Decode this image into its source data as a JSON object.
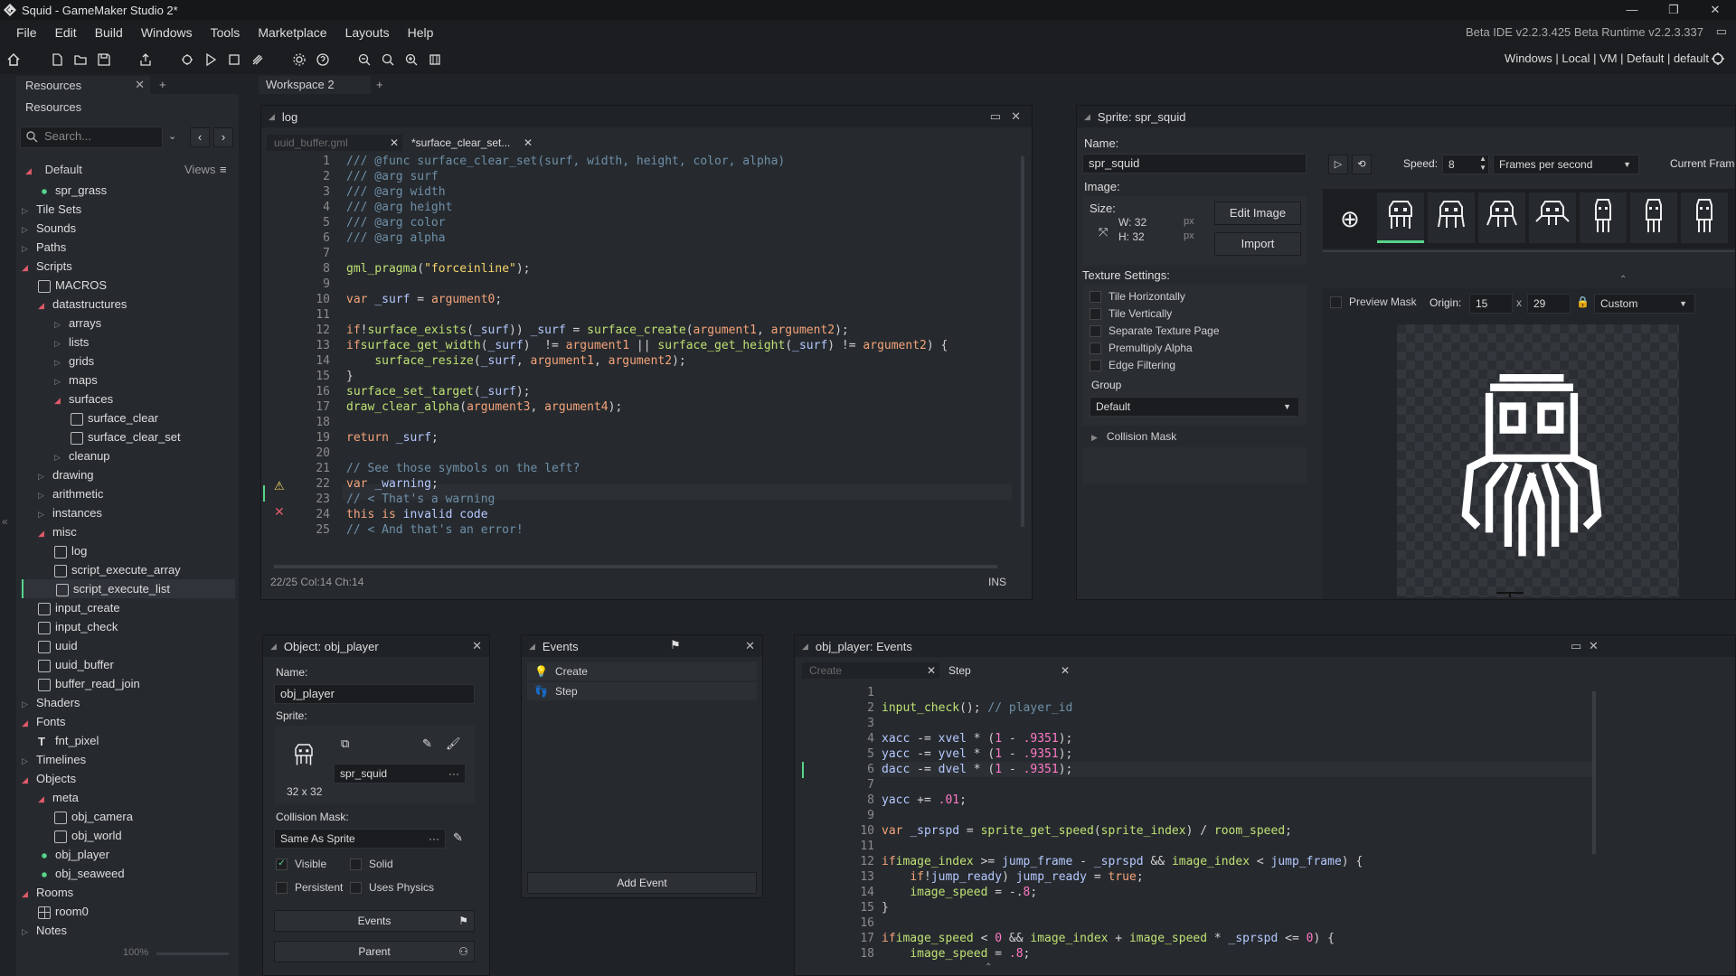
{
  "window": {
    "title": "Squid - GameMaker Studio 2*",
    "minimize": "—",
    "restore": "❐",
    "close": "✕"
  },
  "menu": [
    "File",
    "Edit",
    "Build",
    "Windows",
    "Tools",
    "Marketplace",
    "Layouts",
    "Help"
  ],
  "version": "Beta IDE v2.2.3.425 Beta Runtime v2.2.3.337",
  "targets": "Windows | Local | VM | Default | default",
  "resources": {
    "tab": "Resources",
    "panel_title": "Resources",
    "search_placeholder": "Search...",
    "group": "Default",
    "views": "Views",
    "zoom": "100%",
    "tree": [
      {
        "label": "spr_grass",
        "indent": 1,
        "icon": "sprite"
      },
      {
        "label": "Tile Sets",
        "indent": 0,
        "tri": "closed"
      },
      {
        "label": "Sounds",
        "indent": 0,
        "tri": "closed"
      },
      {
        "label": "Paths",
        "indent": 0,
        "tri": "closed"
      },
      {
        "label": "Scripts",
        "indent": 0,
        "tri": "open"
      },
      {
        "label": "MACROS",
        "indent": 1,
        "icon": "script"
      },
      {
        "label": "datastructures",
        "indent": 1,
        "tri": "open"
      },
      {
        "label": "arrays",
        "indent": 2,
        "tri": "closed"
      },
      {
        "label": "lists",
        "indent": 2,
        "tri": "closed"
      },
      {
        "label": "grids",
        "indent": 2,
        "tri": "closed"
      },
      {
        "label": "maps",
        "indent": 2,
        "tri": "closed"
      },
      {
        "label": "surfaces",
        "indent": 2,
        "tri": "open"
      },
      {
        "label": "surface_clear",
        "indent": 3,
        "icon": "script"
      },
      {
        "label": "surface_clear_set",
        "indent": 3,
        "icon": "script"
      },
      {
        "label": "cleanup",
        "indent": 2,
        "tri": "closed"
      },
      {
        "label": "drawing",
        "indent": 1,
        "tri": "closed"
      },
      {
        "label": "arithmetic",
        "indent": 1,
        "tri": "closed"
      },
      {
        "label": "instances",
        "indent": 1,
        "tri": "closed"
      },
      {
        "label": "misc",
        "indent": 1,
        "tri": "open"
      },
      {
        "label": "log",
        "indent": 2,
        "icon": "script"
      },
      {
        "label": "script_execute_array",
        "indent": 2,
        "icon": "script"
      },
      {
        "label": "script_execute_list",
        "indent": 2,
        "icon": "script",
        "selected": true
      },
      {
        "label": "input_create",
        "indent": 1,
        "icon": "script"
      },
      {
        "label": "input_check",
        "indent": 1,
        "icon": "script"
      },
      {
        "label": "uuid",
        "indent": 1,
        "icon": "script"
      },
      {
        "label": "uuid_buffer",
        "indent": 1,
        "icon": "script"
      },
      {
        "label": "buffer_read_join",
        "indent": 1,
        "icon": "script"
      },
      {
        "label": "Shaders",
        "indent": 0,
        "tri": "closed"
      },
      {
        "label": "Fonts",
        "indent": 0,
        "tri": "open"
      },
      {
        "label": "fnt_pixel",
        "indent": 1,
        "icon": "font"
      },
      {
        "label": "Timelines",
        "indent": 0,
        "tri": "closed"
      },
      {
        "label": "Objects",
        "indent": 0,
        "tri": "open"
      },
      {
        "label": "meta",
        "indent": 1,
        "tri": "open"
      },
      {
        "label": "obj_camera",
        "indent": 2,
        "icon": "object"
      },
      {
        "label": "obj_world",
        "indent": 2,
        "icon": "object"
      },
      {
        "label": "obj_player",
        "indent": 1,
        "icon": "sprite"
      },
      {
        "label": "obj_seaweed",
        "indent": 1,
        "icon": "sprite"
      },
      {
        "label": "Rooms",
        "indent": 0,
        "tri": "open"
      },
      {
        "label": "room0",
        "indent": 1,
        "icon": "room"
      },
      {
        "label": "Notes",
        "indent": 0,
        "tri": "closed"
      }
    ]
  },
  "workspace": {
    "tab": "Workspace 2",
    "add": "+"
  },
  "log": {
    "title": "log",
    "tabs": [
      "uuid_buffer.gml",
      "*surface_clear_set..."
    ],
    "status": "22/25 Col:14 Ch:14",
    "mode": "INS",
    "lines": [
      "/// @func surface_clear_set(surf, width, height, color, alpha)",
      "/// @arg surf",
      "/// @arg width",
      "/// @arg height",
      "/// @arg color",
      "/// @arg alpha",
      "",
      "gml_pragma(\"forceinline\");",
      "",
      "var _surf = argument0;",
      "",
      "if (!surface_exists(_surf)) _surf = surface_create(argument1, argument2);",
      "if (surface_get_width(_surf)  != argument1 || surface_get_height(_surf) != argument2) {",
      "    surface_resize(_surf, argument1, argument2);",
      "}",
      "surface_set_target(_surf);",
      "draw_clear_alpha(argument3, argument4);",
      "",
      "return _surf;",
      "",
      "// See those symbols on the left?",
      "var _warning;",
      "// < That's a warning",
      "this is invalid code",
      "// < And that's an error!"
    ]
  },
  "sprite": {
    "title": "Sprite: spr_squid",
    "name_label": "Name:",
    "name": "spr_squid",
    "image_label": "Image:",
    "size_label": "Size:",
    "w": "W: 32",
    "h": "H: 32",
    "px": "px",
    "edit": "Edit Image",
    "import": "Import",
    "speed_label": "Speed:",
    "speed": "8",
    "fps": "Frames per second",
    "current_frame": "Current Frame",
    "texture_label": "Texture Settings:",
    "options": [
      "Tile Horizontally",
      "Tile Vertically",
      "Separate Texture Page",
      "Premultiply Alpha",
      "Edge Filtering"
    ],
    "group_label": "Group",
    "group": "Default",
    "collision": "Collision Mask",
    "preview_mask": "Preview Mask",
    "origin_label": "Origin:",
    "origin_x": "15",
    "origin_y": "29",
    "origin_x_sep": "x",
    "origin_mode": "Custom"
  },
  "object": {
    "title": "Object: obj_player",
    "name_label": "Name:",
    "name": "obj_player",
    "sprite_label": "Sprite:",
    "sprite": "spr_squid",
    "sprite_size": "32 x 32",
    "mask_label": "Collision Mask:",
    "mask": "Same As Sprite",
    "visible": "Visible",
    "solid": "Solid",
    "persistent": "Persistent",
    "physics": "Uses Physics",
    "events_btn": "Events",
    "parent_btn": "Parent",
    "ellipsis": "···"
  },
  "events": {
    "title": "Events",
    "items": [
      "Create",
      "Step"
    ],
    "add": "Add Event"
  },
  "objevents": {
    "title": "obj_player: Events",
    "tabs": [
      "Create",
      "Step"
    ],
    "lines": [
      "",
      "input_check(); // player_id",
      "",
      "xacc -= xvel * (1 - .9351);",
      "yacc -= yvel * (1 - .9351);",
      "dacc -= dvel * (1 - .9351);",
      "",
      "yacc += .01;",
      "",
      "var _sprspd = sprite_get_speed(sprite_index) / room_speed;",
      "",
      "if (image_index >= jump_frame - _sprspd && image_index < jump_frame) {",
      "    if (!jump_ready) jump_ready = true;",
      "    image_speed = -.8;",
      "}",
      "",
      "if (image_speed < 0 && image_index + image_speed * _sprspd <= 0) {",
      "    image_speed = .8;"
    ]
  },
  "colors": {
    "bg": "#1f2226",
    "panel": "#262a2e",
    "accent": "#57d48a",
    "error": "#e05a6a"
  }
}
